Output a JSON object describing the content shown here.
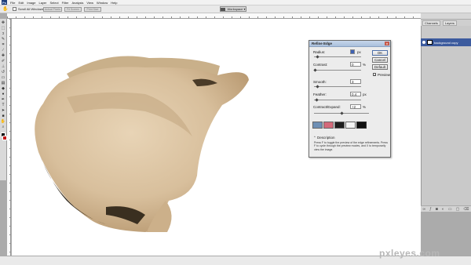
{
  "app": {
    "logo": "Ps"
  },
  "menu": [
    "File",
    "Edit",
    "Image",
    "Layer",
    "Select",
    "Filter",
    "Analysis",
    "View",
    "Window",
    "Help"
  ],
  "options_bar": {
    "scroll_all_windows": "Scroll All Windows",
    "buttons": [
      "Actual Pixels",
      "Fit Screen",
      "Print Size"
    ],
    "workspace": "Workspace ▾"
  },
  "toolbox": {
    "icons": [
      "move-icon",
      "marquee-icon",
      "lasso-icon",
      "quick-select-icon",
      "crop-icon",
      "eyedropper-icon",
      "healing-icon",
      "brush-icon",
      "clone-stamp-icon",
      "history-brush-icon",
      "eraser-icon",
      "gradient-icon",
      "blur-icon",
      "dodge-icon",
      "pen-icon",
      "type-icon",
      "path-select-icon",
      "shape-icon",
      "hand-icon",
      "zoom-icon"
    ]
  },
  "colors": {
    "foreground": "#000000",
    "background": "#c41818"
  },
  "refine_edge": {
    "title": "Refine Edge",
    "radius_label": "Radius:",
    "radius_value": "",
    "contrast_label": "Contrast:",
    "contrast_value": "0",
    "smooth_label": "Smooth:",
    "smooth_value": "3",
    "feather_label": "Feather:",
    "feather_value": "0.4",
    "contract_label": "Contract/Expand:",
    "contract_value": "+2",
    "unit_px": "px",
    "unit_pct": "%",
    "ok": "OK",
    "cancel": "Cancel",
    "default": "Default",
    "preview": "Preview",
    "description_label": "Description",
    "description_text": "Press F to toggle the preview of the edge refinements. Press F to cycle through the preview modes, and X to temporarily view the image."
  },
  "layers_panel": {
    "tabs": [
      "Channels",
      "Layers"
    ],
    "layer_name": "background copy"
  },
  "watermark": "pxleyes.com"
}
